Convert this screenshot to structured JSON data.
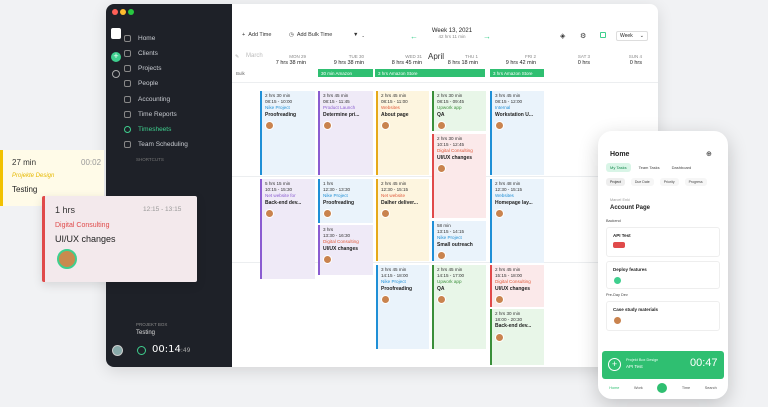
{
  "toolbar": {
    "add_time": "Add Time",
    "add_bulk_time": "Add Bulk Time",
    "week_label": "Week 13, 2021",
    "week_hours": "42 hrs 11 min",
    "view": "Week"
  },
  "sidebar": {
    "items": [
      {
        "label": "Home"
      },
      {
        "label": "Clients"
      },
      {
        "label": "Projects"
      },
      {
        "label": "People"
      },
      {
        "label": "Accounting"
      },
      {
        "label": "Time Reports"
      },
      {
        "label": "Timesheets"
      },
      {
        "label": "Team Scheduling"
      }
    ],
    "shortcuts": "SHORTCUTS",
    "timer_project": "PROJEKT BOX",
    "timer_task": "Testing",
    "timer_time": "00:14",
    "timer_sec": ":49"
  },
  "calendar": {
    "month_left": "March",
    "month_right": "April",
    "label_col": "Bulk",
    "columns": [
      {
        "day": "MON 29",
        "hours": "7 hrs 38 min"
      },
      {
        "day": "TUE 30",
        "hours": "9 hrs 38 min"
      },
      {
        "day": "WED 31",
        "hours": "8 hrs 45 min"
      },
      {
        "day": "THU 1",
        "hours": "8 hrs 18 min"
      },
      {
        "day": "FRI 2",
        "hours": "9 hrs 42 min"
      },
      {
        "day": "SAT 3",
        "hours": "0 hrs"
      },
      {
        "day": "SUN 4",
        "hours": "0 hrs"
      }
    ],
    "bars": [
      "30 min Amazon",
      "3 hrs Amazon Store",
      "3 hrs Amazon Store"
    ],
    "entries": [
      {
        "dur": "2 hrs 30 min",
        "time": "08:15 - 10:00",
        "project": "Nike Project",
        "task": "Proofreading"
      },
      {
        "dur": "5 hrs 15 min",
        "time": "10:15 - 15:30",
        "project": "Net website for",
        "task": "Back-end dev..."
      },
      {
        "dur": "3 hrs 45 min",
        "time": "08:15 - 11:45",
        "project": "Product Launch",
        "task": "Determine pri..."
      },
      {
        "dur": "1 hrs",
        "time": "12:30 - 13:30",
        "project": "Nike Project",
        "task": "Proofreading"
      },
      {
        "dur": "3 hrs",
        "time": "13:30 - 16:30",
        "project": "Digital Consulting",
        "task": "UI/UX changes"
      },
      {
        "dur": "2 hrs 45 min",
        "time": "08:15 - 11:00",
        "project": "Websites",
        "task": "About page"
      },
      {
        "dur": "2 hrs 45 min",
        "time": "12:30 - 15:15",
        "project": "Net website",
        "task": "Dalher deliver..."
      },
      {
        "dur": "3 hrs 45 min",
        "time": "14:15 - 18:00",
        "project": "Nike Project",
        "task": "Proofreading"
      },
      {
        "dur": "2 hrs 30 min",
        "time": "08:15 - 09:45",
        "project": "Upwork app",
        "task": "QA"
      },
      {
        "dur": "2 hrs 30 min",
        "time": "10:15 - 12:45",
        "project": "Digital Consulting",
        "task": "UI/UX changes"
      },
      {
        "dur": "58 min",
        "time": "13:15 - 14:15",
        "project": "Nike Project",
        "task": "Small outreach"
      },
      {
        "dur": "2 hrs 45 min",
        "time": "14:15 - 17:00",
        "project": "Upwork app",
        "task": "QA"
      },
      {
        "dur": "3 hrs 45 min",
        "time": "08:15 - 12:00",
        "project": "Internal",
        "task": "Workstation U..."
      },
      {
        "dur": "2 hrs 48 min",
        "time": "12:30 - 15:15",
        "project": "Websites",
        "task": "Homepage lay..."
      },
      {
        "dur": "2 hrs 45 min",
        "time": "15:15 - 18:00",
        "project": "Digital Consulting",
        "task": "UI/UX changes"
      },
      {
        "dur": "2 hrs 30 min",
        "time": "18:00 - 20:30",
        "project": "",
        "task": "Back-end dev..."
      }
    ]
  },
  "floating_card_1": {
    "dur": "27 min",
    "time": "00:02",
    "project": "Projekte Design",
    "task": "Testing"
  },
  "floating_card_2": {
    "dur": "1 hrs",
    "time": "12:15 - 13:15",
    "project": "Digital Consulting",
    "task": "UI/UX changes"
  },
  "phone": {
    "title": "Home",
    "tabs": [
      "My Tasks",
      "Team Tasks",
      "Dashboard"
    ],
    "subtabs": [
      "Project",
      "Due Date",
      "Priority",
      "Progress"
    ],
    "group": "Marcel Enki",
    "page": "Account Page",
    "section1": "Backend",
    "task1": "API Test",
    "task2": "Deploy features",
    "section2": "Pre-Day Dev",
    "task3": "Case study materials",
    "timer_project": "Projekt Box Design",
    "timer_task": "API Test",
    "timer_time": "00:47",
    "nav": [
      "Home",
      "Work",
      "Time",
      "Search"
    ]
  }
}
